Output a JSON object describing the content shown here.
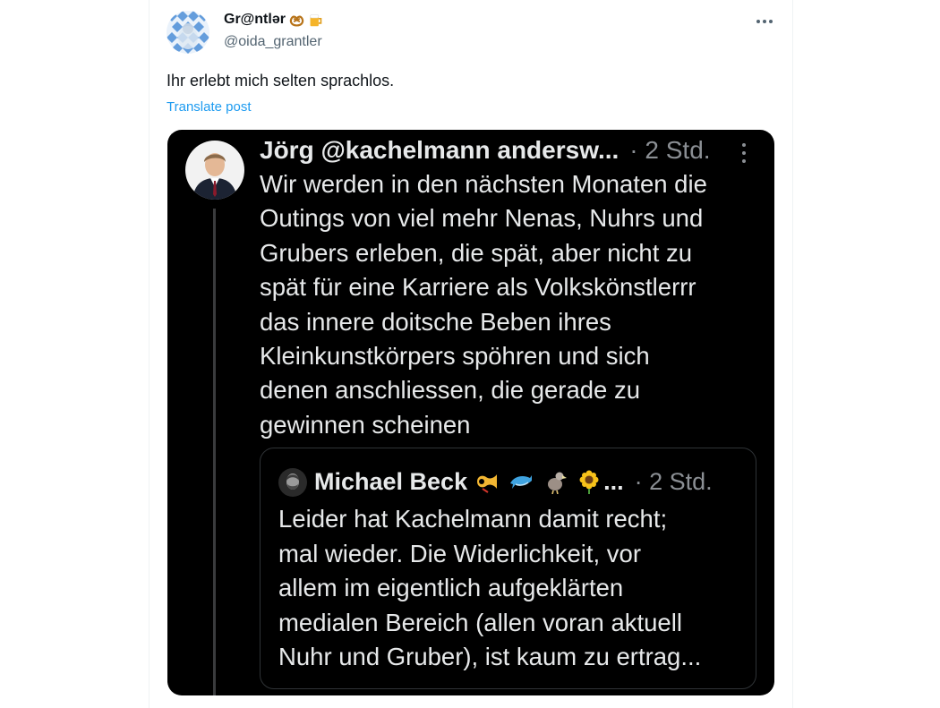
{
  "post": {
    "author": {
      "display_name": "Gr@ntlər",
      "handle": "@oida_grantler",
      "name_emojis": [
        "pretzel-emoji",
        "beer-mug-emoji"
      ]
    },
    "text": "Ihr erlebt mich selten sprachlos.",
    "translate_label": "Translate post"
  },
  "screenshot": {
    "quote": {
      "author_name": "Jörg @kachelmann andersw...",
      "meta": "· 2 Std.",
      "lines": [
        "Wir werden in den nächsten Monaten die",
        "Outings von viel mehr Nenas, Nuhrs und",
        "Grubers erleben, die spät, aber nicht zu",
        "spät für eine Karriere als Volkskönstlerrr",
        "das innere doitsche Beben ihres",
        "Kleinkunstkörpers spöhren und sich",
        "denen anschliessen, die gerade zu",
        "gewinnen scheinen"
      ]
    },
    "inner_quote": {
      "author_name": "Michael Beck",
      "emojis": [
        "postal-horn-emoji",
        "dolphin-emoji",
        "dodo-emoji",
        "sunflower-emoji"
      ],
      "ellipsis": "...",
      "meta": "· 2 Std.",
      "lines": [
        "Leider hat Kachelmann damit recht;",
        "mal wieder. Die Widerlichkeit, vor",
        "allem im eigentlich aufgeklärten",
        "medialen Bereich (allen voran aktuell",
        "Nuhr und Gruber), ist kaum zu ertrag..."
      ]
    }
  },
  "colors": {
    "link": "#1d9bf0",
    "secondary_text": "#536471",
    "dark_bg": "#000000",
    "dark_text": "#e7e9ea",
    "dark_meta": "#8b8f94"
  }
}
